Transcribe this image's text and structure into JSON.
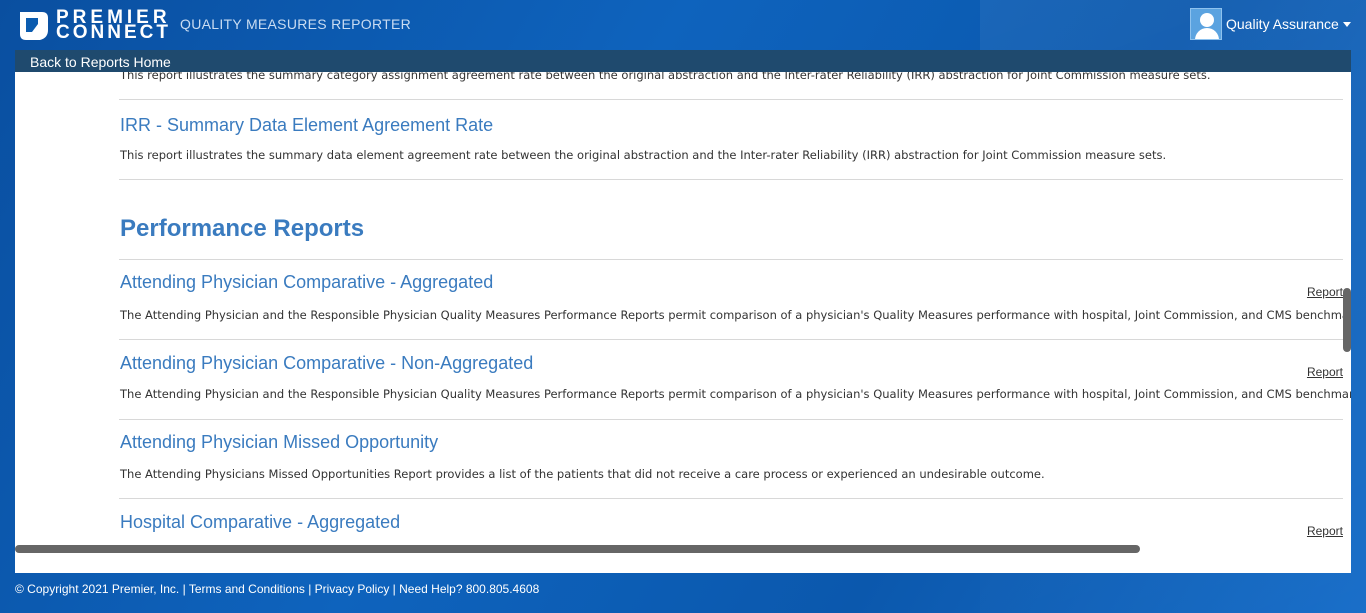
{
  "header": {
    "logo_line1": "PREMIER",
    "logo_line2": "CONNECT",
    "app_title": "QUALITY MEASURES REPORTER",
    "user_name": "Quality Assurance"
  },
  "nav": {
    "back_label": "Back to Reports Home"
  },
  "reports_top": [
    {
      "title": "",
      "description": "This report illustrates the summary category assignment agreement rate between the original abstraction and the Inter-rater Reliability (IRR) abstraction for Joint Commission measure sets."
    },
    {
      "title": "IRR - Summary Data Element Agreement Rate",
      "description": "This report illustrates the summary data element agreement rate between the original abstraction and the Inter-rater Reliability (IRR) abstraction for Joint Commission measure sets."
    }
  ],
  "performance": {
    "heading": "Performance Reports",
    "items": [
      {
        "title": "Attending Physician Comparative - Aggregated",
        "description": "The Attending Physician and the Responsible Physician Quality Measures Performance Reports permit comparison of a physician's Quality Measures performance with hospital, Joint Commission, and CMS benchmarks.",
        "link": "Report"
      },
      {
        "title": "Attending Physician Comparative - Non-Aggregated",
        "description": "The Attending Physician and the Responsible Physician Quality Measures Performance Reports permit comparison of a physician's Quality Measures performance with hospital, Joint Commission, and CMS benchmarks.",
        "link": "Report"
      },
      {
        "title": "Attending Physician Missed Opportunity",
        "description": "The Attending Physicians Missed Opportunities Report provides a list of the patients that did not receive a care process or experienced an undesirable outcome.",
        "link": ""
      },
      {
        "title": "Hospital Comparative - Aggregated",
        "description": "",
        "link": "Report"
      }
    ]
  },
  "footer": {
    "text": "© Copyright 2021 Premier, Inc. | Terms and Conditions | Privacy Policy | Need Help? 800.805.4608"
  },
  "colors": {
    "header_bg": "#0b5cb0",
    "backbar_bg": "#1f4a6e",
    "link_blue": "#3a7bbf"
  }
}
